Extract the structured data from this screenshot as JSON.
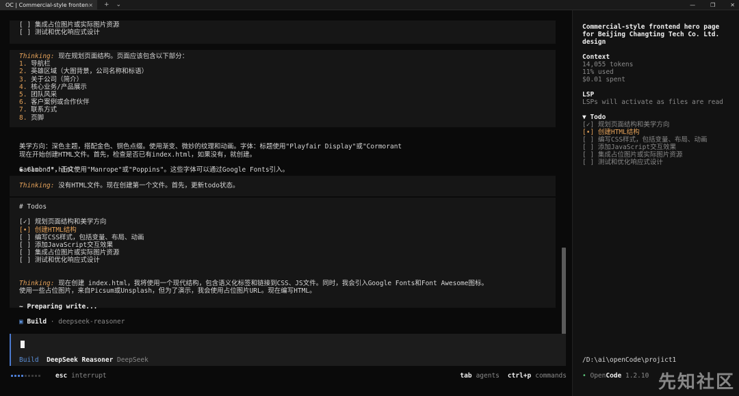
{
  "window": {
    "tab_title": "OC | Commercial-style fronten",
    "tab_close": "×",
    "new_tab": "+",
    "tab_menu": "⌄",
    "minimize": "—",
    "maximize": "❐",
    "close": "✕"
  },
  "transcript": {
    "block1": [
      "[ ] 集成占位图片或实际图片资源",
      "[ ] 测试和优化响应式设计"
    ],
    "thinking1_label": "Thinking:",
    "thinking1_text": " 现在规划页面结构。页面应该包含以下部分：",
    "sections": [
      {
        "n": "1.",
        "t": " 导航栏"
      },
      {
        "n": "2.",
        "t": " 英雄区域（大图背景，公司名称和标语）"
      },
      {
        "n": "3.",
        "t": " 关于公司（简介）"
      },
      {
        "n": "4.",
        "t": " 核心业务/产品展示"
      },
      {
        "n": "5.",
        "t": " 团队风采"
      },
      {
        "n": "6.",
        "t": " 客户案例或合作伙伴"
      },
      {
        "n": "7.",
        "t": " 联系方式"
      },
      {
        "n": "8.",
        "t": " 页脚"
      }
    ],
    "aesthetic_1": "美学方向：深色主题，搭配金色、铜色点缀。使用渐变、微妙的纹理和动画。字体：标题使用\"Playfair Display\"或\"Cormorant",
    "aesthetic_2": "Garamond\"，正文使用\"Manrope\"或\"Poppins\"。这些字体可以通过Google Fonts引入。",
    "create_html": "现在开始创建HTML文件。首先，检查是否已有index.html，如果没有，就创建。",
    "glob": "✱ Glob \"*.html\"",
    "thinking2_label": "Thinking:",
    "thinking2_text": " 没有HTML文件。现在创建第一个文件。首先，更新todo状态。",
    "todos_header": "# Todos",
    "todos": [
      {
        "mark": "[✓]",
        "text": " 规划页面结构和美学方向",
        "state": "done"
      },
      {
        "mark": "[•]",
        "text": " 创建HTML结构",
        "state": "active"
      },
      {
        "mark": "[ ]",
        "text": " 编写CSS样式，包括变量、布局、动画",
        "state": "todo"
      },
      {
        "mark": "[ ]",
        "text": " 添加JavaScript交互效果",
        "state": "todo"
      },
      {
        "mark": "[ ]",
        "text": " 集成占位图片或实际图片资源",
        "state": "todo"
      },
      {
        "mark": "[ ]",
        "text": " 测试和优化响应式设计",
        "state": "todo"
      }
    ],
    "thinking3_label": "Thinking:",
    "thinking3_text1": " 现在创建 index.html，我将使用一个现代结构，包含语义化标签和链接到CSS、JS文件。同时，我会引入Google Fonts和Font Awesome图标。",
    "thinking3_text2": "使用一些占位图片，来自Picsum或Unsplash，但为了演示，我会使用占位图片URL。现在编写HTML。",
    "preparing": "~ Preparing write...",
    "build_icon": "▣",
    "build_label": "Build",
    "build_model": " · deepseek-reasoner"
  },
  "input": {
    "mode": "Build",
    "model": "DeepSeek Reasoner",
    "provider": "DeepSeek"
  },
  "status": {
    "esc_key": "esc",
    "esc_action": "interrupt",
    "tab_key": "tab",
    "tab_action": "agents",
    "ctrlp_key": "ctrl+p",
    "ctrlp_action": "commands"
  },
  "sidebar": {
    "title_1": "Commercial-style frontend hero page",
    "title_2": "for Beijing Changting Tech Co. Ltd.",
    "title_3": "design",
    "context_label": "Context",
    "tokens": "14,055 tokens",
    "used": "11% used",
    "spent": "$0.01 spent",
    "lsp_label": "LSP",
    "lsp_text": "LSPs will activate as files are read",
    "todo_label": "▼ Todo",
    "todos": [
      {
        "mark": "[✓]",
        "text": " 规划页面结构和美学方向",
        "state": "done"
      },
      {
        "mark": "[•]",
        "text": " 创建HTML结构",
        "state": "active"
      },
      {
        "mark": "[ ]",
        "text": " 编写CSS样式，包括变量、布局、动画",
        "state": "todo"
      },
      {
        "mark": "[ ]",
        "text": " 添加JavaScript交互效果",
        "state": "todo"
      },
      {
        "mark": "[ ]",
        "text": " 集成占位图片或实际图片资源",
        "state": "todo"
      },
      {
        "mark": "[ ]",
        "text": " 测试和优化响应式设计",
        "state": "todo"
      }
    ],
    "path": "/D:\\ai\\openCode\\projict1",
    "dot": "•",
    "app_name_1": "Open",
    "app_name_2": "Code",
    "version": " 1.2.10"
  },
  "watermark": "先知社区",
  "colors": {
    "accent": "#e5a25a",
    "blue": "#5b8fd8",
    "green": "#5ac47a",
    "bg": "#0a0a0a",
    "panel": "#161616"
  }
}
